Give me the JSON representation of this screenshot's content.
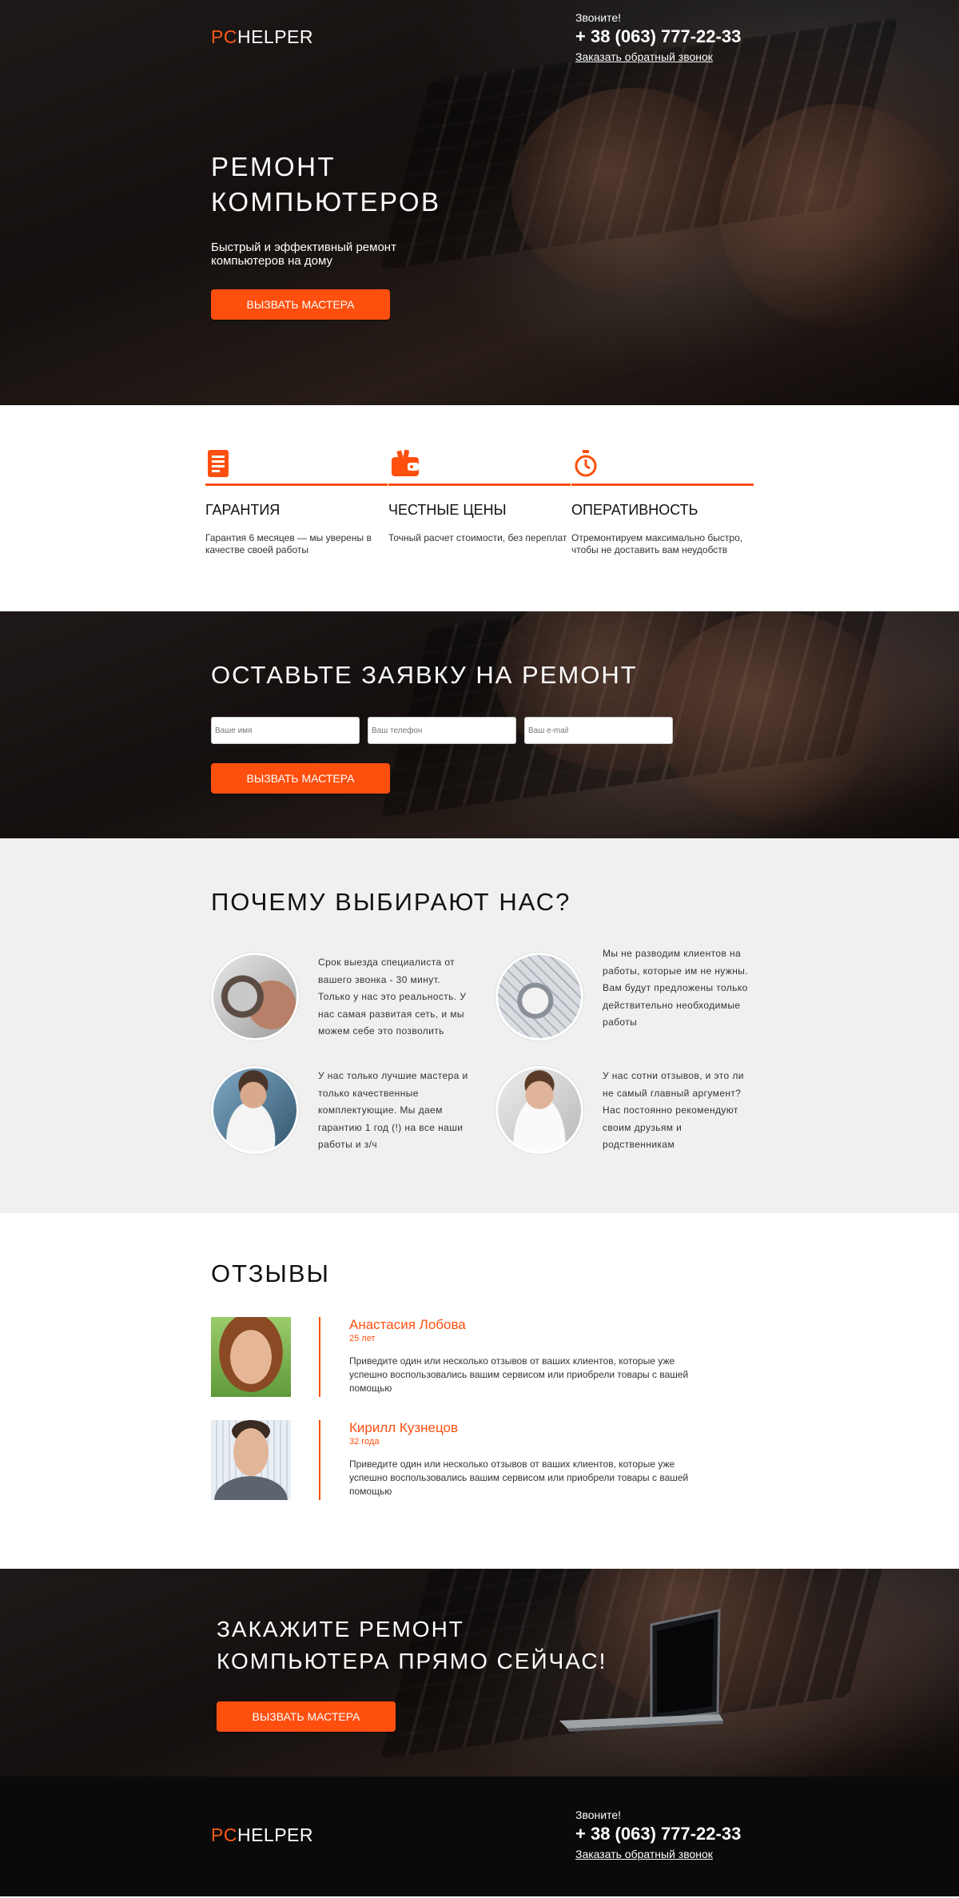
{
  "header": {
    "logo_accent": "PC",
    "logo_rest": "HELPER",
    "call_label": "Звоните!",
    "phone": "+ 38 (063) 777-22-33",
    "callback_link": "Заказать обратный звонок"
  },
  "hero": {
    "title_line1": "РЕМОНТ",
    "title_line2": "КОМПЬЮТЕРОВ",
    "subtitle": "Быстрый и эффективный ремонт компьютеров на дому",
    "button": "Вызвать мастера"
  },
  "features": [
    {
      "icon": "document-icon",
      "title": "ГАРАНТИЯ",
      "text": "Гарантия 6 месяцев — мы уверены в качестве своей работы"
    },
    {
      "icon": "wallet-icon",
      "title": "ЧЕСТНЫЕ ЦЕНЫ",
      "text": "Точный расчет стоимости, без переплат"
    },
    {
      "icon": "stopwatch-icon",
      "title": "ОПЕРАТИВНОСТЬ",
      "text": "Отремонтируем максимально быстро, чтобы не доставить вам неудобств"
    }
  ],
  "form": {
    "title": "ОСТАВЬТЕ ЗАЯВКУ НА РЕМОНТ",
    "name_placeholder": "Ваше имя",
    "phone_placeholder": "Ваш телефон",
    "email_placeholder": "Ваш e-mail",
    "button": "Вызвать мастера"
  },
  "why": {
    "title": "ПОЧЕМУ ВЫБИРАЮТ НАС?",
    "items": [
      {
        "icon": "wristwatch-photo",
        "text": "Срок выезда специалиста от вашего звонка - 30 минут. Только у нас это реальность. У нас самая развитая сеть, и мы можем себе это позволить"
      },
      {
        "icon": "stethoscope-keyboard-photo",
        "text": "Мы не разводим клиентов на работы, которые им не нужны. Вам будут предложены только действительно необходимые работы"
      },
      {
        "icon": "technician-photo",
        "text": "У нас только лучшие мастера и только качественные комплектующие. Мы даем гарантию 1 год (!) на все наши работы и з/ч"
      },
      {
        "icon": "support-operator-photo",
        "text": "У нас сотни отзывов, и это ли не самый главный аргумент? Нас постоянно рекомендуют своим друзьям и родственникам"
      }
    ]
  },
  "reviews": {
    "title": "ОТЗЫВЫ",
    "items": [
      {
        "name": "Анастасия Лобова",
        "age": "25 лет",
        "text": "Приведите один или несколько отзывов от ваших клиентов, которые уже успешно воспользовались вашим сервисом или приобрели товары с вашей помощью"
      },
      {
        "name": "Кирилл Кузнецов",
        "age": "32 года",
        "text": "Приведите один или несколько отзывов от ваших клиентов, которые уже успешно воспользовались вашим сервисом или приобрели товары с вашей помощью"
      }
    ]
  },
  "cta": {
    "title_line1": "ЗАКАЖИТЕ РЕМОНТ",
    "title_line2": "КОМПЬЮТЕРА ПРЯМО СЕЙЧАС!",
    "button": "Вызвать мастера"
  },
  "colors": {
    "accent": "#ff4f0f",
    "dark": "#0a0a0a",
    "light_gray": "#f0f0f0"
  }
}
